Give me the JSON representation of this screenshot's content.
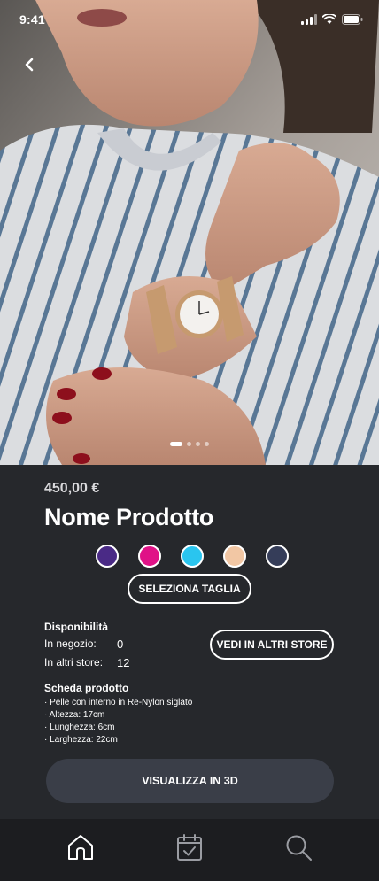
{
  "status_bar": {
    "time": "9:41"
  },
  "hero": {
    "carousel": {
      "count": 4,
      "active_index": 0
    },
    "back_icon": "chevron-left-icon"
  },
  "product": {
    "price": "450,00 €",
    "name": "Nome Prodotto",
    "colors": [
      "#4a2a86",
      "#e01287",
      "#2ac5ef",
      "#f2c7a4",
      "#353d59"
    ],
    "size_button": "SELEZIONA TAGLIA"
  },
  "availability": {
    "title": "Disponibilità",
    "in_store_label": "In negozio:",
    "in_store_value": "0",
    "other_stores_label": "In altri store:",
    "other_stores_value": "12",
    "other_stores_button": "VEDI IN ALTRI STORE"
  },
  "specs": {
    "title": "Scheda prodotto",
    "items": [
      "· Pelle con interno in Re-Nylon siglato",
      "· Altezza: 17cm",
      "· Lunghezza: 6cm",
      "· Larghezza: 22cm"
    ]
  },
  "view3d_button": "VISUALIZZA IN 3D",
  "tabbar": {
    "items": [
      {
        "icon": "home-icon"
      },
      {
        "icon": "calendar-check-icon"
      },
      {
        "icon": "search-icon"
      }
    ]
  },
  "colors": {
    "background": "#26282c",
    "tabbar": "#1c1d20",
    "button": "#3a3e48"
  }
}
